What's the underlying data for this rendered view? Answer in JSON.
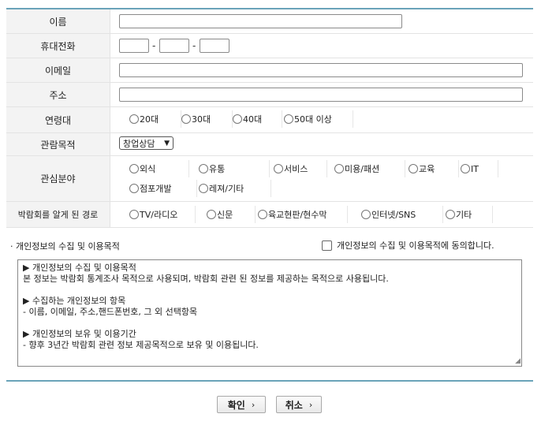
{
  "form": {
    "name": {
      "label": "이름",
      "value": ""
    },
    "phone": {
      "label": "휴대전화",
      "sep1": "-",
      "sep2": "-",
      "part1": "",
      "part2": "",
      "part3": ""
    },
    "email": {
      "label": "이메일",
      "value": ""
    },
    "address": {
      "label": "주소",
      "value": ""
    },
    "age": {
      "label": "연령대",
      "options": [
        "20대",
        "30대",
        "40대",
        "50대 이상"
      ]
    },
    "purpose": {
      "label": "관람목적",
      "selected": "창업상담"
    },
    "interest": {
      "label": "관심분야",
      "row1": [
        "외식",
        "유통",
        "서비스",
        "미용/패션",
        "교육",
        "IT"
      ],
      "row2": [
        "점포개발",
        "레져/기타"
      ]
    },
    "route": {
      "label": "박람회를 알게 된 경로",
      "options": [
        "TV/라디오",
        "신문",
        "육교현판/현수막",
        "인터넷/SNS",
        "기타"
      ]
    }
  },
  "privacy": {
    "section_title": "· 개인정보의 수집 및 이용목적",
    "agree_label": "개인정보의 수집 및 이용목적에 동의합니다.",
    "lines": [
      "▶ 개인정보의 수집 및 이용목적",
      "본 정보는 박람회 통계조사 목적으로 사용되며, 박람회 관련 된 정보를 제공하는 목적으로 사용됩니다.",
      "",
      "▶ 수집하는 개인정보의 항목",
      "- 이름, 이메일, 주소,핸드폰번호, 그 외 선택항목",
      "",
      "▶ 개인정보의 보유 및 이용기간",
      "- 향후 3년간 박람회 관련 정보 제공목적으로 보유 및 이용됩니다."
    ]
  },
  "buttons": {
    "confirm": "확인",
    "cancel": "취소",
    "arrow": "›"
  }
}
